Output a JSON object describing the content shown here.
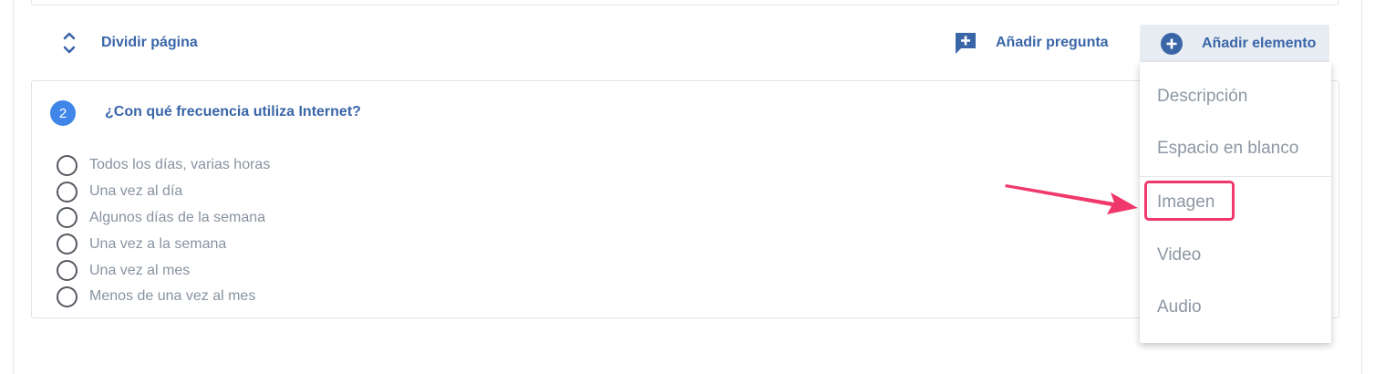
{
  "toolbar": {
    "split_page_label": "Dividir página",
    "split_page_icon": "expand-collapse-icon",
    "add_question_label": "Añadir pregunta",
    "add_question_icon": "add-comment-icon",
    "add_element_label": "Añadir elemento",
    "add_element_icon": "plus-circle-icon"
  },
  "question": {
    "number": "2",
    "title": "¿Con qué frecuencia utiliza Internet?",
    "options": [
      "Todos los días, varias horas",
      "Una vez al día",
      "Algunos días de la semana",
      "Una vez a la semana",
      "Una vez al mes",
      "Menos de una vez al mes"
    ]
  },
  "dropdown": {
    "items": [
      "Descripción",
      "Espacio en blanco",
      "Imagen",
      "Video",
      "Audio"
    ],
    "highlighted_item": "Imagen"
  },
  "colors": {
    "accent": "#3a66a8",
    "badge": "#3f86e8",
    "highlight": "#f0386a",
    "button_bg": "#e8edf3"
  }
}
